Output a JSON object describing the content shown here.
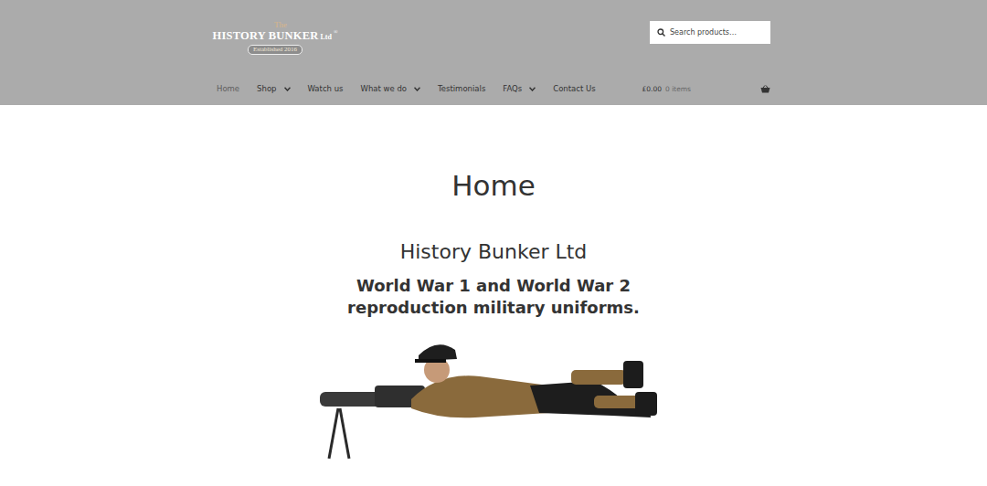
{
  "logo": {
    "small": "The",
    "name": "HISTORY BUNKER",
    "suffix": "Ltd",
    "reg": "®",
    "badge": "Established 2016"
  },
  "search": {
    "placeholder": "Search products…"
  },
  "nav": [
    {
      "label": "Home",
      "selected": true,
      "has_menu": false
    },
    {
      "label": "Shop",
      "selected": false,
      "has_menu": true
    },
    {
      "label": "Watch us",
      "selected": false,
      "has_menu": false
    },
    {
      "label": "What we do",
      "selected": false,
      "has_menu": true
    },
    {
      "label": "Testimonials",
      "selected": false,
      "has_menu": false
    },
    {
      "label": "FAQs",
      "selected": false,
      "has_menu": true
    },
    {
      "label": "Contact Us",
      "selected": false,
      "has_menu": false
    }
  ],
  "cart": {
    "total": "£0.00",
    "count": "0 items"
  },
  "page": {
    "title": "Home",
    "heading": "History Bunker Ltd",
    "tagline": "World War 1 and World War 2  reproduction military uniforms."
  }
}
